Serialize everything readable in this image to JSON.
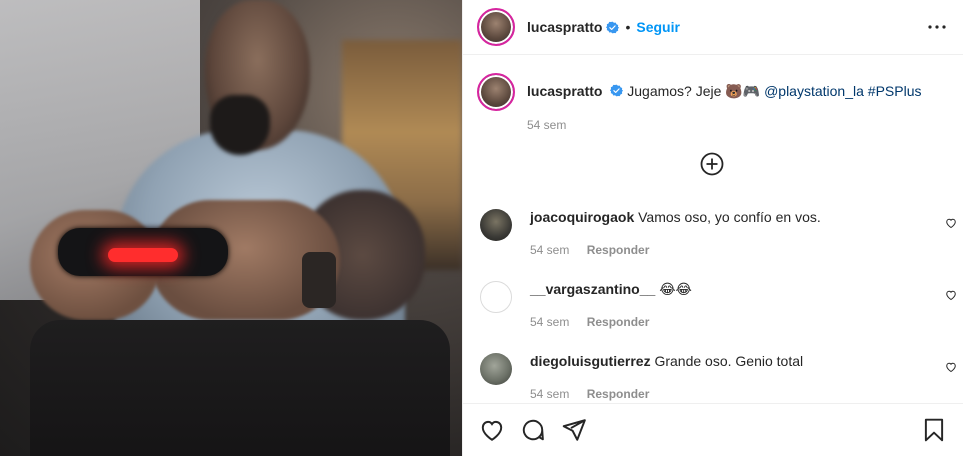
{
  "post": {
    "username": "lucaspratto",
    "follow_label": "Seguir",
    "separator": "•",
    "caption": {
      "username": "lucaspratto",
      "text": "Jugamos? Jeje",
      "emojis": "🐻🎮",
      "mention": "@playstation_la",
      "hashtag": "#PSPlus",
      "time": "54 sem"
    }
  },
  "comments": [
    {
      "username": "joacoquirogaok",
      "text": "Vamos oso, yo confío en vos.",
      "time": "54 sem",
      "reply_label": "Responder",
      "avatar_color": "#3b3a36"
    },
    {
      "username": "__vargaszantino__",
      "text": "😂😂",
      "time": "54 sem",
      "reply_label": "Responder",
      "avatar_color": "#ffffff"
    },
    {
      "username": "diegoluisgutierrez",
      "text": "Grande oso. Genio total",
      "time": "54 sem",
      "reply_label": "Responder",
      "avatar_color": "#6d7268"
    }
  ],
  "icons": {
    "more": "more-options-icon",
    "verified": "verified-badge-icon",
    "add_comments": "plus-circle-icon",
    "like": "heart-icon",
    "comment": "comment-icon",
    "share": "send-icon",
    "save": "bookmark-icon"
  },
  "colors": {
    "accent": "#0095f6",
    "link": "#00376b",
    "muted": "#8e8e8e",
    "story_ring": "#d6249f"
  }
}
